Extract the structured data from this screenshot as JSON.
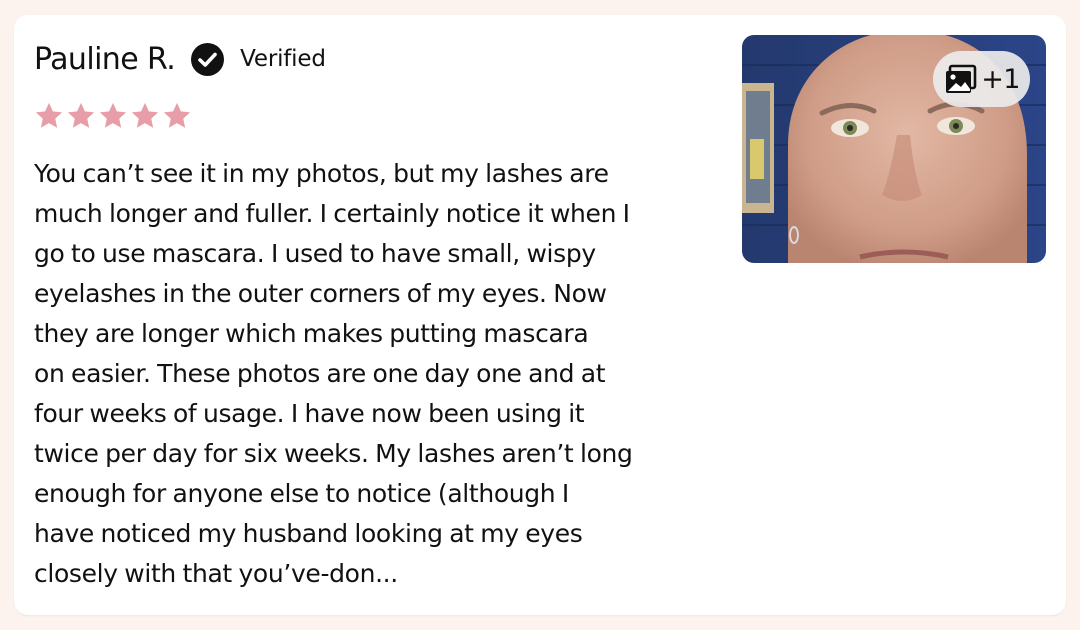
{
  "review": {
    "reviewer_name": "Pauline R.",
    "verified_label": "Verified",
    "rating": 5,
    "star_color": "#e79ea8",
    "verified_icon": "check-circle-icon",
    "body_lines": [
      "You can’t see it in my photos, but my lashes are",
      "much longer and fuller. I certainly notice it when I",
      "go to use mascara. I used to have small, wispy",
      "eyelashes in the outer corners of my eyes. Now",
      "they are longer which makes putting mascara",
      "on easier. These photos are one day one and at",
      "four weeks of usage. I have now been using it",
      "twice per day for six weeks. My lashes aren’t long",
      "enough for anyone else to notice (although I",
      "have noticed my husband looking at my eyes",
      "closely with that you’ve-don..."
    ],
    "photo": {
      "extra_count": "+1",
      "gallery_icon": "images-icon"
    }
  }
}
